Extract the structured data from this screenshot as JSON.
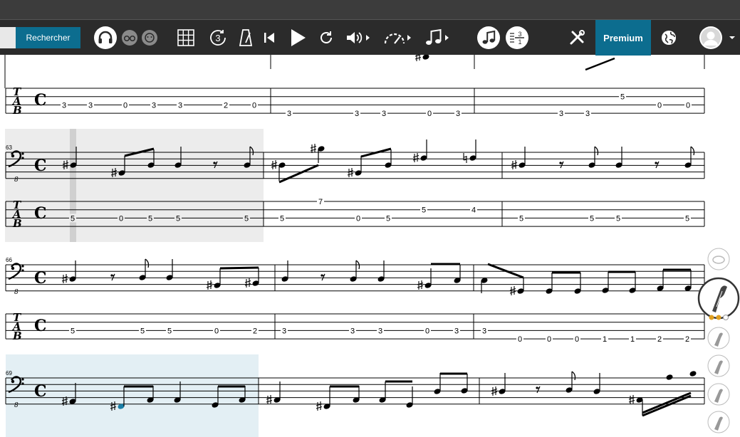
{
  "toolbar": {
    "search_button": "Rechercher",
    "search_value": "",
    "premium_label": "Premium",
    "countin_label": "3",
    "fraction_top": "3",
    "fraction_bottom": "1"
  },
  "score": {
    "clef": "C",
    "measure_numbers": [
      "63",
      "66",
      "69"
    ],
    "octave_marking": "8",
    "tab_labels": [
      "T",
      "A",
      "B"
    ],
    "rows": [
      {
        "tab": [
          [
            "3",
            "3",
            "0",
            "3",
            "3",
            "2",
            "0"
          ],
          [
            "3",
            "3",
            "3",
            "0",
            "3"
          ],
          [
            "5",
            "3",
            "3",
            "0",
            "0"
          ]
        ]
      },
      {
        "tab": [
          [
            "5",
            "0",
            "5",
            "5",
            "5"
          ],
          [
            "5",
            "7",
            "0",
            "5",
            "5",
            "4"
          ],
          [
            "5",
            "5",
            "5",
            "5"
          ]
        ]
      },
      {
        "tab": [
          [
            "5",
            "5",
            "5",
            "0",
            "2"
          ],
          [
            "3",
            "3",
            "3",
            "0",
            "3"
          ],
          [
            "3",
            "0",
            "0",
            "0",
            "1",
            "1",
            "2",
            "2"
          ]
        ]
      }
    ]
  },
  "colors": {
    "accent": "#0c6d8f",
    "toolbar_bg": "#2b2b2b",
    "selection_gray": "#ececec",
    "selection_blue": "#e3eff4",
    "cursor": "#d0d0d0",
    "active_note": "#1a7fa8"
  }
}
